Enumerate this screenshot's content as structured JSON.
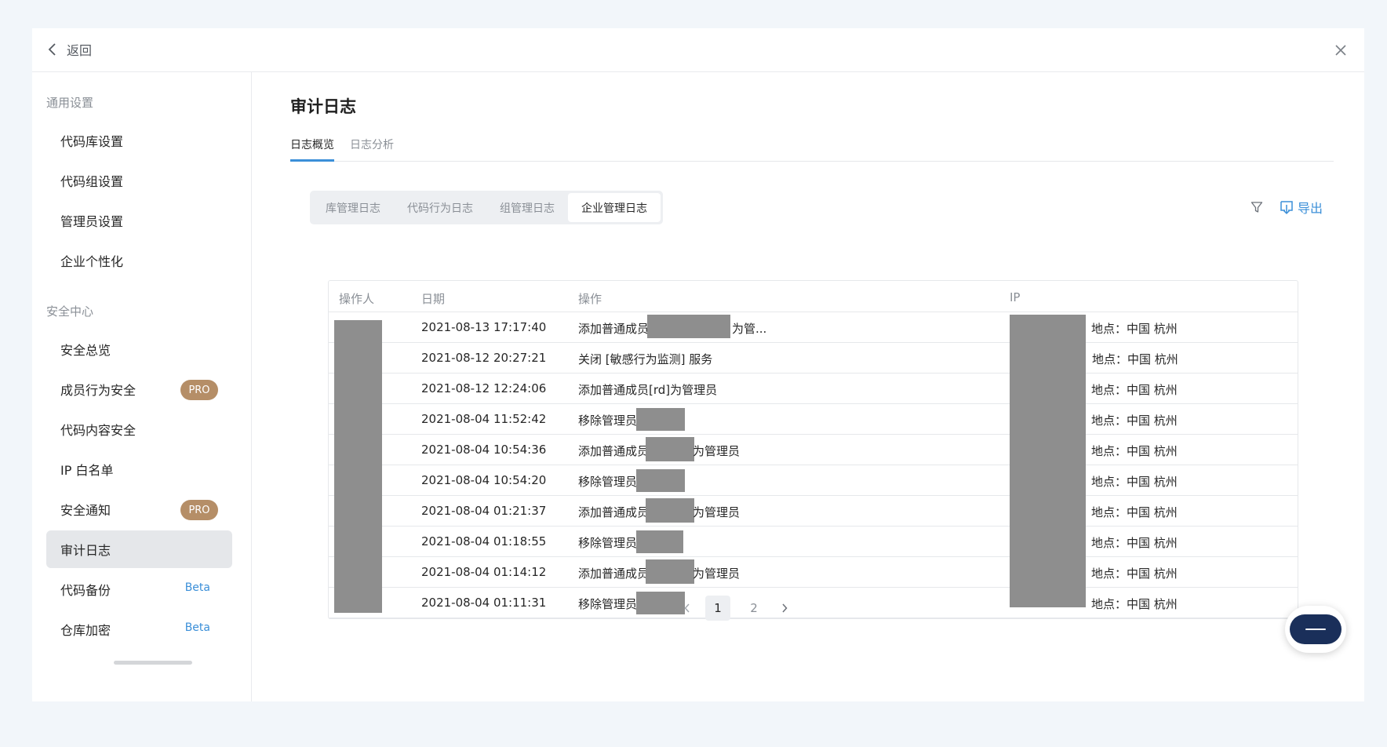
{
  "topbar": {
    "back_label": "返回"
  },
  "sidebar": {
    "general_section": "通用设置",
    "general_items": [
      "代码库设置",
      "代码组设置",
      "管理员设置",
      "企业个性化"
    ],
    "security_section": "安全中心",
    "security_items": [
      {
        "label": "安全总览",
        "badge": ""
      },
      {
        "label": "成员行为安全",
        "badge": "PRO"
      },
      {
        "label": "代码内容安全",
        "badge": ""
      },
      {
        "label": "IP 白名单",
        "badge": ""
      },
      {
        "label": "安全通知",
        "badge": "PRO"
      },
      {
        "label": "审计日志",
        "badge": "",
        "active": true
      },
      {
        "label": "代码备份",
        "badge": "Beta"
      },
      {
        "label": "仓库加密",
        "badge": "Beta"
      }
    ]
  },
  "main": {
    "title": "审计日志",
    "tabs": [
      "日志概览",
      "日志分析"
    ],
    "active_tab": 0,
    "segments": [
      "库管理日志",
      "代码行为日志",
      "组管理日志",
      "企业管理日志"
    ],
    "active_segment": 3,
    "export_label": "导出"
  },
  "table": {
    "columns": [
      "操作人",
      "日期",
      "操作",
      "IP"
    ],
    "rows": [
      {
        "date": "2021-08-13 17:17:40",
        "op_pre": "添加普通成员",
        "op_post": "为管...",
        "location": "地点：中国 杭州"
      },
      {
        "date": "2021-08-12 20:27:21",
        "op_pre": "关闭 [敏感行为监测] 服务",
        "op_post": "",
        "location": "地点：中国 杭州"
      },
      {
        "date": "2021-08-12 12:24:06",
        "op_pre": "添加普通成员[rd]为管理员",
        "op_post": "",
        "location": "地点：中国 杭州"
      },
      {
        "date": "2021-08-04 11:52:42",
        "op_pre": "移除管理员",
        "op_post": "",
        "location": "地点：中国 杭州"
      },
      {
        "date": "2021-08-04 10:54:36",
        "op_pre": "添加普通成员",
        "op_post": "为管理员",
        "location": "地点：中国 杭州"
      },
      {
        "date": "2021-08-04 10:54:20",
        "op_pre": "移除管理员",
        "op_post": "",
        "location": "地点：中国 杭州"
      },
      {
        "date": "2021-08-04 01:21:37",
        "op_pre": "添加普通成员",
        "op_post": "为管理员",
        "location": "地点：中国 杭州"
      },
      {
        "date": "2021-08-04 01:18:55",
        "op_pre": "移除管理员",
        "op_post": "",
        "location": "地点：中国 杭州"
      },
      {
        "date": "2021-08-04 01:14:12",
        "op_pre": "添加普通成员",
        "op_post": "为管理员",
        "location": "地点：中国 杭州"
      },
      {
        "date": "2021-08-04 01:11:31",
        "op_pre": "移除管理员",
        "op_post": "",
        "location": "地点：中国 杭州"
      }
    ]
  },
  "pagination": {
    "pages": [
      "1",
      "2"
    ],
    "current": "1"
  },
  "colors": {
    "accent": "#3b8fd8",
    "pro_badge": "#b58e67",
    "redaction": "#8e8e8e",
    "float_button": "#1a2f5a"
  }
}
